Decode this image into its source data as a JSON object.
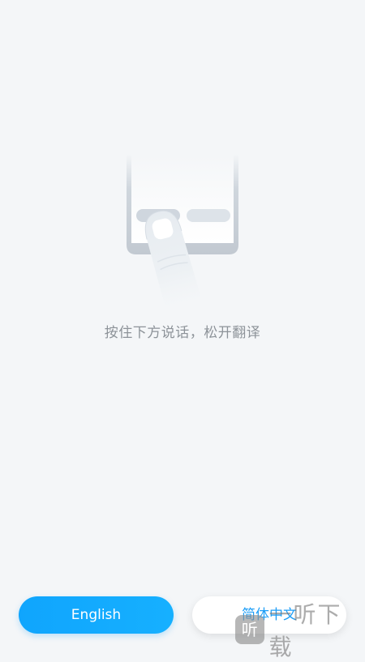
{
  "main": {
    "hint_text": "按住下方说话，松开翻译"
  },
  "language_buttons": {
    "english_label": "English",
    "chinese_label": "简体中文"
  },
  "watermark": {
    "logo_glyph": "听",
    "text": "一听下载"
  },
  "colors": {
    "background": "#f4f6f8",
    "accent": "#10a5fd",
    "hint_text": "#8d9399"
  }
}
